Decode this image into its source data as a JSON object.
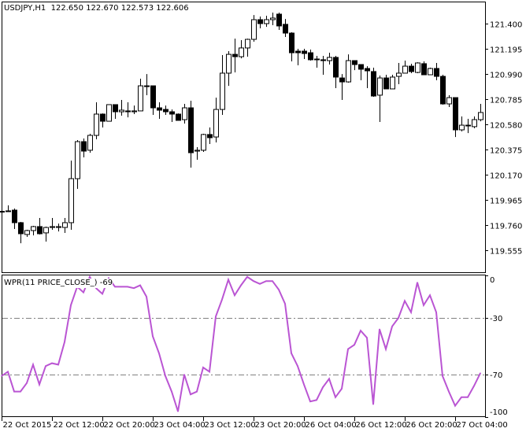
{
  "header": {
    "symbol": "USDJPY,H1",
    "ohlc": "122.650 122.670 122.573 122.606"
  },
  "indicator": {
    "label": "WPR(11 PRICE_CLOSE_)",
    "current_value": "-69",
    "levels": [
      -30,
      -70
    ],
    "axis_labels": [
      "0",
      "-30",
      "-70",
      "-100"
    ],
    "line_color": "#BA55D3",
    "level_color": "#808080"
  },
  "price_axis": [
    "121.400",
    "121.195",
    "120.990",
    "120.785",
    "120.580",
    "120.375",
    "120.170",
    "119.965",
    "119.760",
    "119.555"
  ],
  "time_axis": [
    "22 Oct 2015",
    "22 Oct 12:00",
    "22 Oct 20:00",
    "23 Oct 04:00",
    "23 Oct 12:00",
    "23 Oct 20:00",
    "26 Oct 04:00",
    "26 Oct 12:00",
    "26 Oct 20:00",
    "27 Oct 04:00"
  ],
  "chart_data": [
    {
      "type": "candlestick",
      "title": "USDJPY,H1",
      "ylim": [
        119.52,
        121.59
      ],
      "ohlc_order": [
        "open",
        "high",
        "low",
        "close"
      ],
      "candles": [
        [
          119.873,
          119.877,
          119.87,
          119.873
        ],
        [
          119.873,
          119.922,
          119.87,
          119.877
        ],
        [
          119.883,
          119.896,
          119.73,
          119.781
        ],
        [
          119.781,
          119.787,
          119.614,
          119.691
        ],
        [
          119.685,
          119.723,
          119.666,
          119.717
        ],
        [
          119.717,
          119.755,
          119.678,
          119.749
        ],
        [
          119.749,
          119.819,
          119.685,
          119.691
        ],
        [
          119.698,
          119.749,
          119.627,
          119.742
        ],
        [
          119.742,
          119.819,
          119.723,
          119.749
        ],
        [
          119.742,
          119.774,
          119.71,
          119.749
        ],
        [
          119.742,
          119.819,
          119.698,
          119.781
        ],
        [
          119.781,
          120.286,
          119.723,
          120.139
        ],
        [
          120.139,
          120.453,
          120.056,
          120.44
        ],
        [
          120.44,
          120.466,
          120.312,
          120.363
        ],
        [
          120.37,
          120.504,
          120.35,
          120.491
        ],
        [
          120.491,
          120.76,
          120.459,
          120.664
        ],
        [
          120.664,
          120.67,
          120.555,
          120.606
        ],
        [
          120.606,
          120.741,
          120.606,
          120.741
        ],
        [
          120.741,
          120.741,
          120.626,
          120.683
        ],
        [
          120.683,
          120.779,
          120.651,
          120.696
        ],
        [
          120.69,
          120.76,
          120.638,
          120.683
        ],
        [
          120.683,
          120.734,
          120.664,
          120.69
        ],
        [
          120.69,
          120.952,
          120.69,
          120.894
        ],
        [
          120.888,
          120.99,
          120.818,
          120.894
        ],
        [
          120.894,
          120.894,
          120.658,
          120.715
        ],
        [
          120.715,
          120.76,
          120.626,
          120.696
        ],
        [
          120.702,
          120.734,
          120.658,
          120.683
        ],
        [
          120.683,
          120.702,
          120.6,
          120.664
        ],
        [
          120.664,
          120.67,
          120.613,
          120.613
        ],
        [
          120.619,
          120.747,
          120.587,
          120.715
        ],
        [
          120.715,
          120.773,
          120.229,
          120.35
        ],
        [
          120.363,
          120.395,
          120.293,
          120.37
        ],
        [
          120.37,
          120.504,
          120.357,
          120.498
        ],
        [
          120.498,
          120.555,
          120.421,
          120.472
        ],
        [
          120.478,
          120.798,
          120.434,
          120.702
        ],
        [
          120.702,
          121.144,
          120.658,
          120.997
        ],
        [
          120.997,
          121.176,
          120.894,
          121.15
        ],
        [
          121.15,
          121.278,
          121.003,
          121.131
        ],
        [
          121.131,
          121.266,
          121.118,
          121.202
        ],
        [
          121.202,
          121.278,
          121.131,
          121.272
        ],
        [
          121.272,
          121.47,
          121.253,
          121.432
        ],
        [
          121.432,
          121.458,
          121.362,
          121.4
        ],
        [
          121.4,
          121.464,
          121.374,
          121.432
        ],
        [
          121.432,
          121.49,
          121.387,
          121.445
        ],
        [
          121.477,
          121.49,
          121.349,
          121.381
        ],
        [
          121.394,
          121.438,
          121.291,
          121.323
        ],
        [
          121.323,
          121.33,
          121.093,
          121.163
        ],
        [
          121.176,
          121.195,
          121.061,
          121.163
        ],
        [
          121.176,
          121.195,
          121.112,
          121.157
        ],
        [
          121.163,
          121.189,
          121.099,
          121.106
        ],
        [
          121.112,
          121.138,
          121.042,
          121.106
        ],
        [
          121.106,
          121.138,
          120.984,
          121.099
        ],
        [
          121.099,
          121.163,
          121.067,
          121.125
        ],
        [
          121.125,
          121.138,
          120.875,
          120.965
        ],
        [
          120.958,
          120.99,
          120.779,
          120.926
        ],
        [
          120.926,
          121.15,
          120.92,
          121.099
        ],
        [
          121.099,
          121.099,
          121.022,
          121.067
        ],
        [
          121.067,
          121.067,
          120.939,
          121.029
        ],
        [
          121.035,
          121.054,
          120.875,
          121.016
        ],
        [
          121.01,
          121.042,
          120.805,
          120.811
        ],
        [
          120.818,
          120.978,
          120.6,
          120.958
        ],
        [
          120.958,
          120.984,
          120.869,
          120.869
        ],
        [
          120.869,
          120.984,
          120.869,
          120.965
        ],
        [
          120.971,
          121.08,
          120.907,
          120.997
        ],
        [
          120.997,
          121.099,
          120.997,
          121.054
        ],
        [
          121.054,
          121.074,
          120.997,
          121.01
        ],
        [
          121.003,
          121.086,
          120.997,
          121.08
        ],
        [
          121.074,
          121.093,
          120.984,
          120.984
        ],
        [
          120.984,
          121.042,
          120.984,
          121.035
        ],
        [
          121.035,
          121.08,
          120.939,
          120.971
        ],
        [
          120.971,
          120.984,
          120.741,
          120.747
        ],
        [
          120.747,
          120.818,
          120.722,
          120.798
        ],
        [
          120.798,
          120.798,
          120.478,
          120.536
        ],
        [
          120.536,
          120.645,
          120.523,
          120.574
        ],
        [
          120.574,
          120.626,
          120.51,
          120.568
        ],
        [
          120.562,
          120.645,
          120.549,
          120.619
        ],
        [
          120.619,
          120.747,
          120.606,
          120.677
        ]
      ]
    },
    {
      "type": "line",
      "title": "WPR(11 PRICE_CLOSE_)",
      "ylim": [
        -100,
        0
      ],
      "values": [
        -71,
        -68,
        -82,
        -82,
        -76,
        -63,
        -77,
        -64,
        -62,
        -63,
        -47,
        -21,
        -8,
        -12,
        -1,
        -9,
        -13,
        -2,
        -8,
        -8,
        -8,
        -9,
        -7,
        -15,
        -43,
        -55,
        -71,
        -82,
        -96,
        -70,
        -84,
        -82,
        -65,
        -68,
        -29,
        -17,
        -3,
        -14,
        -7,
        -1,
        -4,
        -6,
        -4,
        -4,
        -10,
        -20,
        -55,
        -64,
        -77,
        -89,
        -88,
        -79,
        -73,
        -86,
        -80,
        -52,
        -49,
        -39,
        -44,
        -91,
        -38,
        -52,
        -36,
        -30,
        -18,
        -26,
        -5,
        -21,
        -14,
        -26,
        -71,
        -82,
        -92,
        -86,
        -86,
        -78,
        -69
      ]
    }
  ]
}
